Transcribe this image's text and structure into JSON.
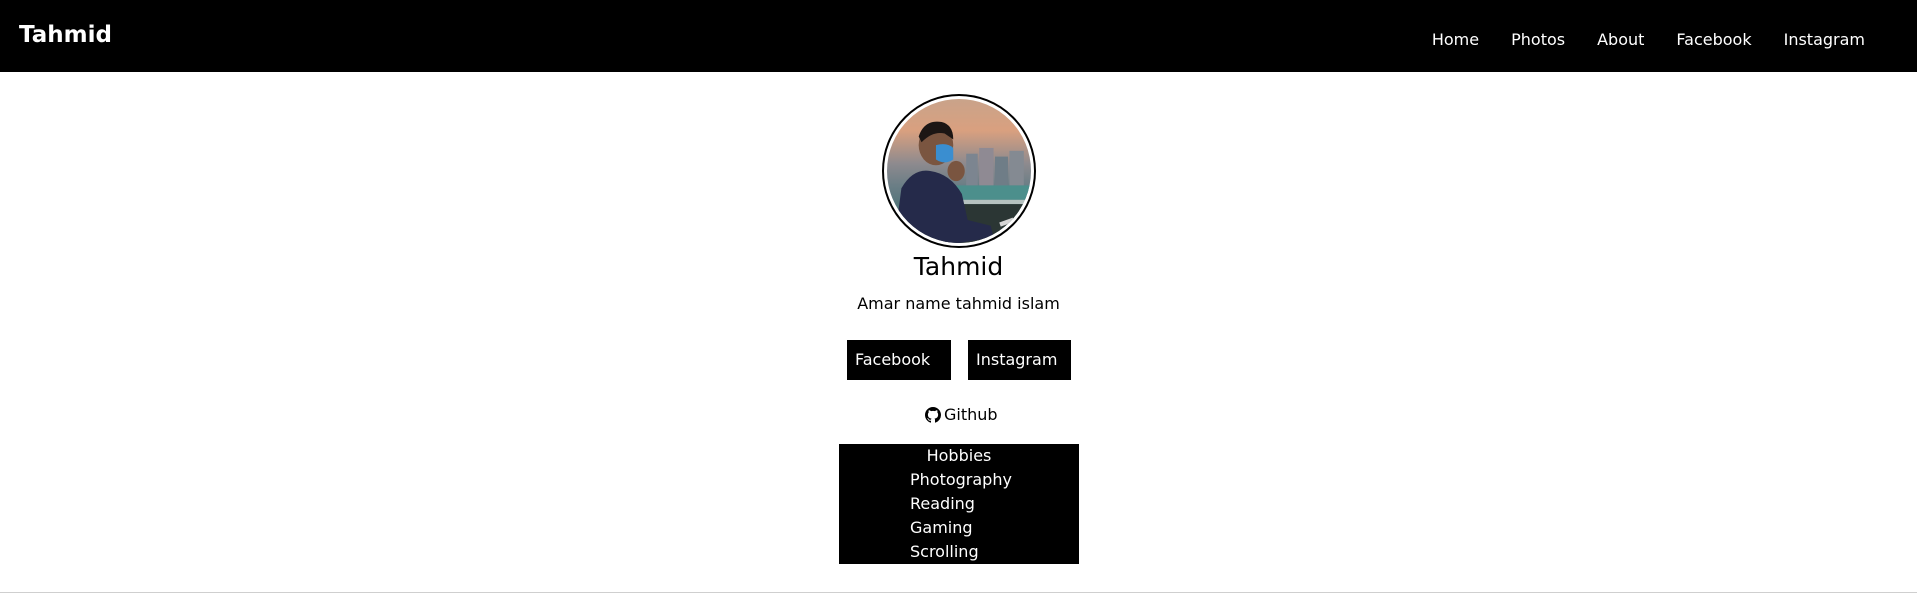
{
  "navbar": {
    "brand": "Tahmid",
    "links": [
      "Home",
      "Photos",
      "About",
      "Facebook",
      "Instagram"
    ]
  },
  "profile": {
    "name": "Tahmid",
    "bio": "Amar name tahmid islam"
  },
  "social": {
    "facebook_label": "Facebook",
    "instagram_label": "Instagram",
    "github_label": "Github",
    "github_icon": "github-icon"
  },
  "hobbies": {
    "title": "Hobbies",
    "items": [
      "Photography",
      "Reading",
      "Gaming",
      "Scrolling"
    ]
  },
  "colors": {
    "navbar_bg": "#000000",
    "text_on_dark": "#ffffff",
    "page_bg": "#ffffff"
  }
}
